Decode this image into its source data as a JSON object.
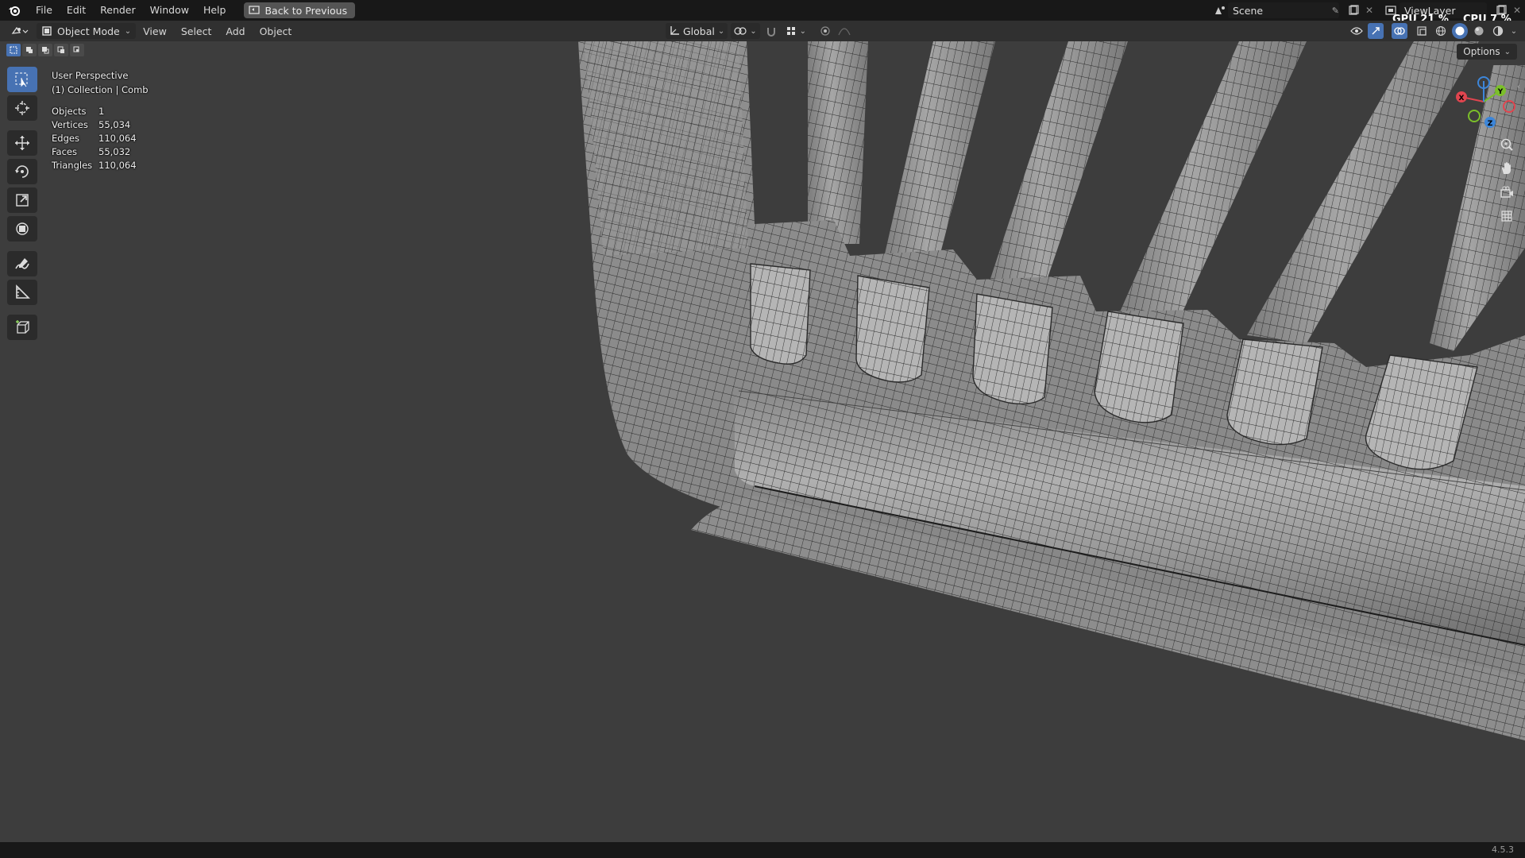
{
  "topbar": {
    "menus": [
      "File",
      "Edit",
      "Render",
      "Window",
      "Help"
    ],
    "back_label": "Back to Previous",
    "scene_name": "Scene",
    "view_layer": "ViewLayer",
    "gpu_label": "GPU",
    "gpu_value": "21 %",
    "cpu_label": "CPU",
    "cpu_value": "7 %"
  },
  "header": {
    "mode": "Object Mode",
    "menus": [
      "View",
      "Select",
      "Add",
      "Object"
    ],
    "orientation": "Global",
    "options_label": "Options"
  },
  "overlay": {
    "perspective": "User Perspective",
    "collection": "(1) Collection | Comb",
    "stats": [
      {
        "label": "Objects",
        "value": "1"
      },
      {
        "label": "Vertices",
        "value": "55,034"
      },
      {
        "label": "Edges",
        "value": "110,064"
      },
      {
        "label": "Faces",
        "value": "55,032"
      },
      {
        "label": "Triangles",
        "value": "110,064"
      }
    ]
  },
  "gizmo": {
    "x": "X",
    "y": "Y",
    "z": "Z",
    "x_color": "#e0454f",
    "y_color": "#7bbf2a",
    "z_color": "#3d86d9"
  },
  "tools": [
    "select-box",
    "cursor",
    "move",
    "rotate",
    "scale",
    "transform",
    "annotate",
    "measure",
    "add-cube"
  ],
  "status": {
    "version": "4.5.3"
  },
  "colors": {
    "accent": "#4772b3",
    "viewport": "#3d3d3d",
    "mesh_face": "#8c8c8c",
    "wire": "#262626"
  }
}
